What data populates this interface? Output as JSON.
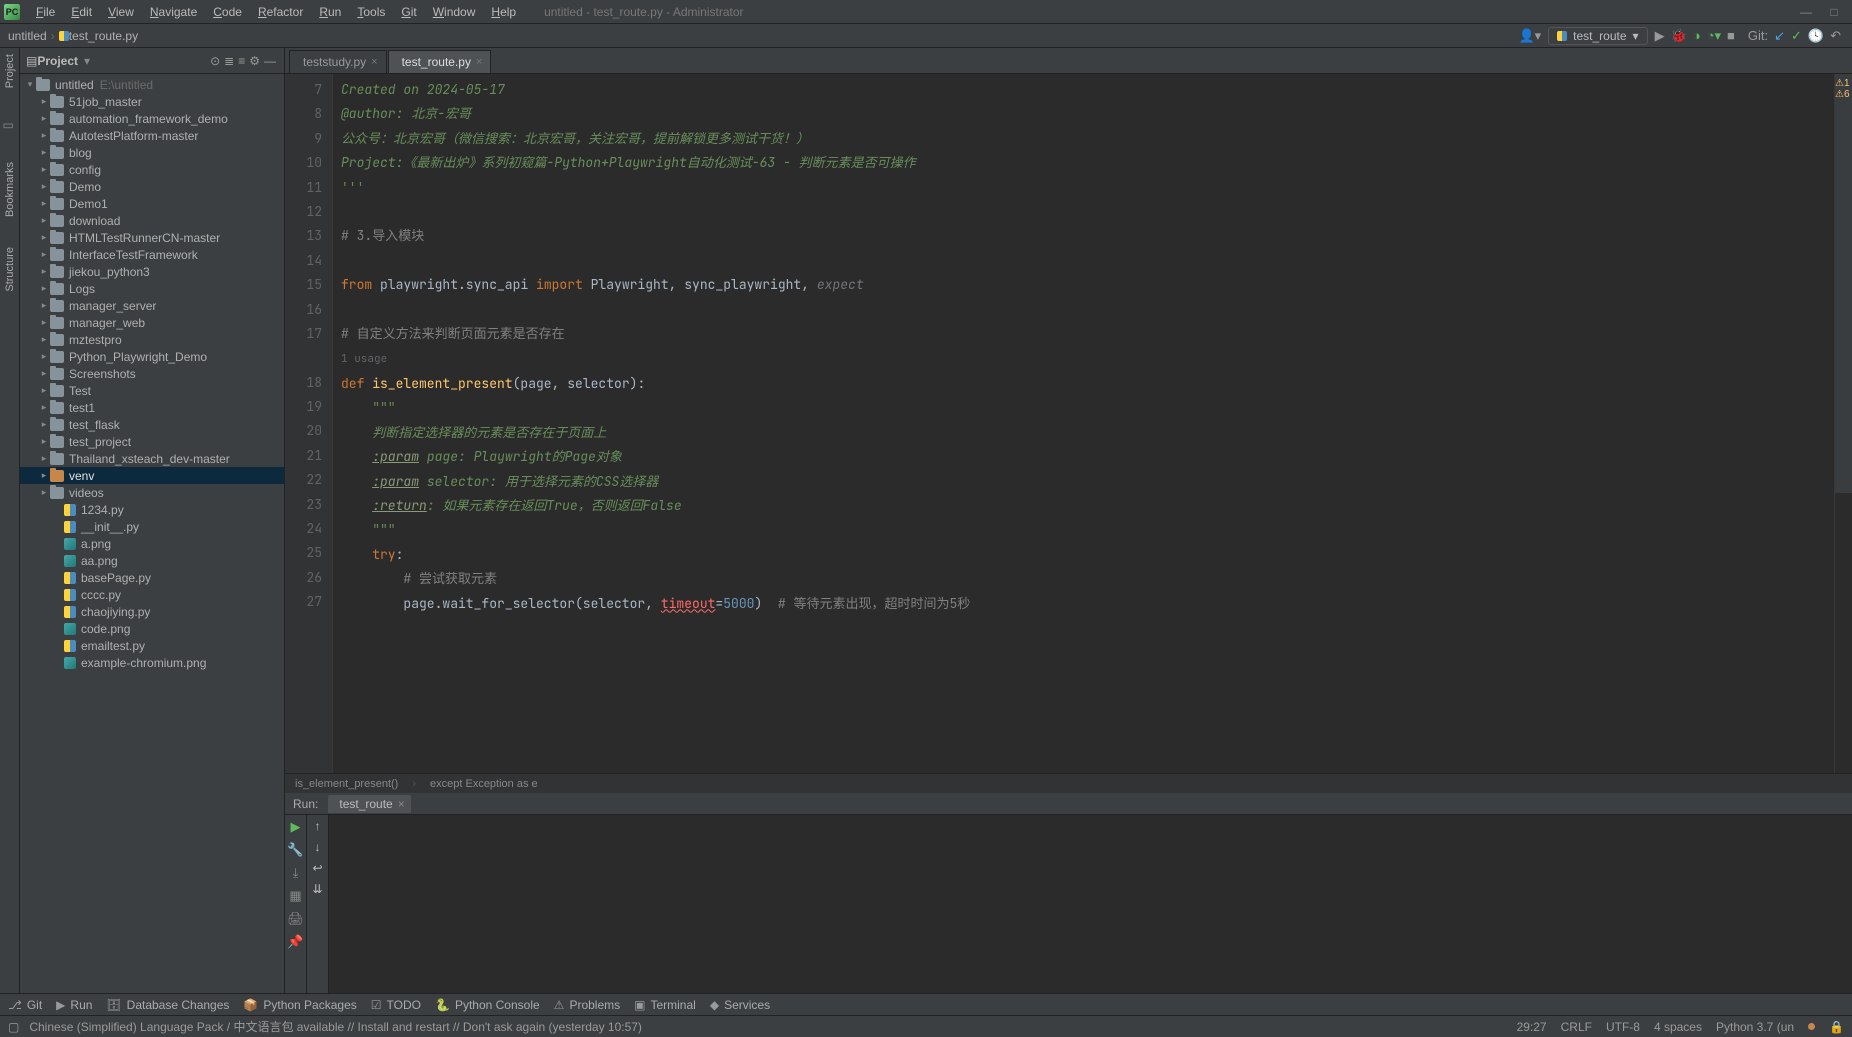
{
  "window": {
    "title": "untitled - test_route.py - Administrator"
  },
  "menu": {
    "items": [
      "File",
      "Edit",
      "View",
      "Navigate",
      "Code",
      "Refactor",
      "Run",
      "Tools",
      "Git",
      "Window",
      "Help"
    ]
  },
  "breadcrumbs": {
    "root": "untitled",
    "file": "test_route.py"
  },
  "run_config": {
    "name": "test_route",
    "git_label": "Git:"
  },
  "project_panel": {
    "title": "Project"
  },
  "tree": {
    "root_name": "untitled",
    "root_path": "E:\\untitled",
    "folders": [
      "51job_master",
      "automation_framework_demo",
      "AutotestPlatform-master",
      "blog",
      "config",
      "Demo",
      "Demo1",
      "download",
      "HTMLTestRunnerCN-master",
      "InterfaceTestFramework",
      "jiekou_python3",
      "Logs",
      "manager_server",
      "manager_web",
      "mztestpro",
      "Python_Playwright_Demo",
      "Screenshots",
      "Test",
      "test1",
      "test_flask",
      "test_project",
      "Thailand_xsteach_dev-master",
      "venv",
      "videos"
    ],
    "files": [
      {
        "name": "1234.py",
        "type": "py"
      },
      {
        "name": "__init__.py",
        "type": "py"
      },
      {
        "name": "a.png",
        "type": "img"
      },
      {
        "name": "aa.png",
        "type": "img"
      },
      {
        "name": "basePage.py",
        "type": "py"
      },
      {
        "name": "cccc.py",
        "type": "py"
      },
      {
        "name": "chaojiying.py",
        "type": "py"
      },
      {
        "name": "code.png",
        "type": "img"
      },
      {
        "name": "emailtest.py",
        "type": "py"
      },
      {
        "name": "example-chromium.png",
        "type": "img"
      }
    ],
    "selected": "venv"
  },
  "editor_tabs": {
    "t0": {
      "label": "teststudy.py",
      "active": false
    },
    "t1": {
      "label": "test_route.py",
      "active": true
    }
  },
  "code_lines": {
    "l7": "Created on 2024-05-17",
    "l8a": "@author:",
    "l8b": " 北京-宏哥",
    "l9": "公众号：北京宏哥（微信搜索：北京宏哥，关注宏哥，提前解锁更多测试干货！）",
    "l10": "Project:《最新出炉》系列初窥篇-Python+Playwright自动化测试-63 - 判断元素是否可操作",
    "l11": "'''",
    "l13": "# 3.导入模块",
    "l15_from": "from",
    "l15_mod": " playwright.sync_api ",
    "l15_imp": "import",
    "l15_rest": " Playwright, sync_playwright, ",
    "l15_exp": "expect",
    "l17": "# 自定义方法来判断页面元素是否存在",
    "l17u": "1 usage",
    "l18_def": "def",
    "l18_fn": " is_element_present",
    "l18_p1": "(page",
    "l18_p2": ", selector)",
    "l18_c": ":",
    "l19": "    \"\"\"",
    "l20": "    判断指定选择器的元素是否存在于页面上",
    "l21t": ":param",
    "l21r": " page: Playwright的Page对象",
    "l22t": ":param",
    "l22r": " selector: 用于选择元素的CSS选择器",
    "l23t": ":return",
    "l23r": ": 如果元素存在返回True，否则返回False",
    "l24": "    \"\"\"",
    "l25_try": "try",
    "l26": "        # 尝试获取元素",
    "l27a": "        page.wait_for_selector(selector, ",
    "l27b": "timeout",
    "l27c": "=",
    "l27d": "5000",
    "l27e": ")",
    "l27f": "  # 等待元素出现，超时时间为5秒"
  },
  "code_breadcrumb": {
    "a": "is_element_present()",
    "b": "except Exception as e"
  },
  "run_panel": {
    "label": "Run:",
    "tab": "test_route"
  },
  "bottom_tools": {
    "git": "Git",
    "run": "Run",
    "db": "Database Changes",
    "pkg": "Python Packages",
    "todo": "TODO",
    "console": "Python Console",
    "problems": "Problems",
    "terminal": "Terminal",
    "services": "Services"
  },
  "statusbar": {
    "msg": "Chinese (Simplified) Language Pack / 中文语言包 available // Install and restart // Don't ask again (yesterday 10:57)",
    "pos": "29:27",
    "crlf": "CRLF",
    "enc": "UTF-8",
    "indent": "4 spaces",
    "python": "Python 3.7 (un"
  },
  "warnings": {
    "text": "⚠1 ⚠6"
  },
  "left_rail": {
    "a": "Project",
    "b": "Bookmarks",
    "c": "Structure"
  }
}
